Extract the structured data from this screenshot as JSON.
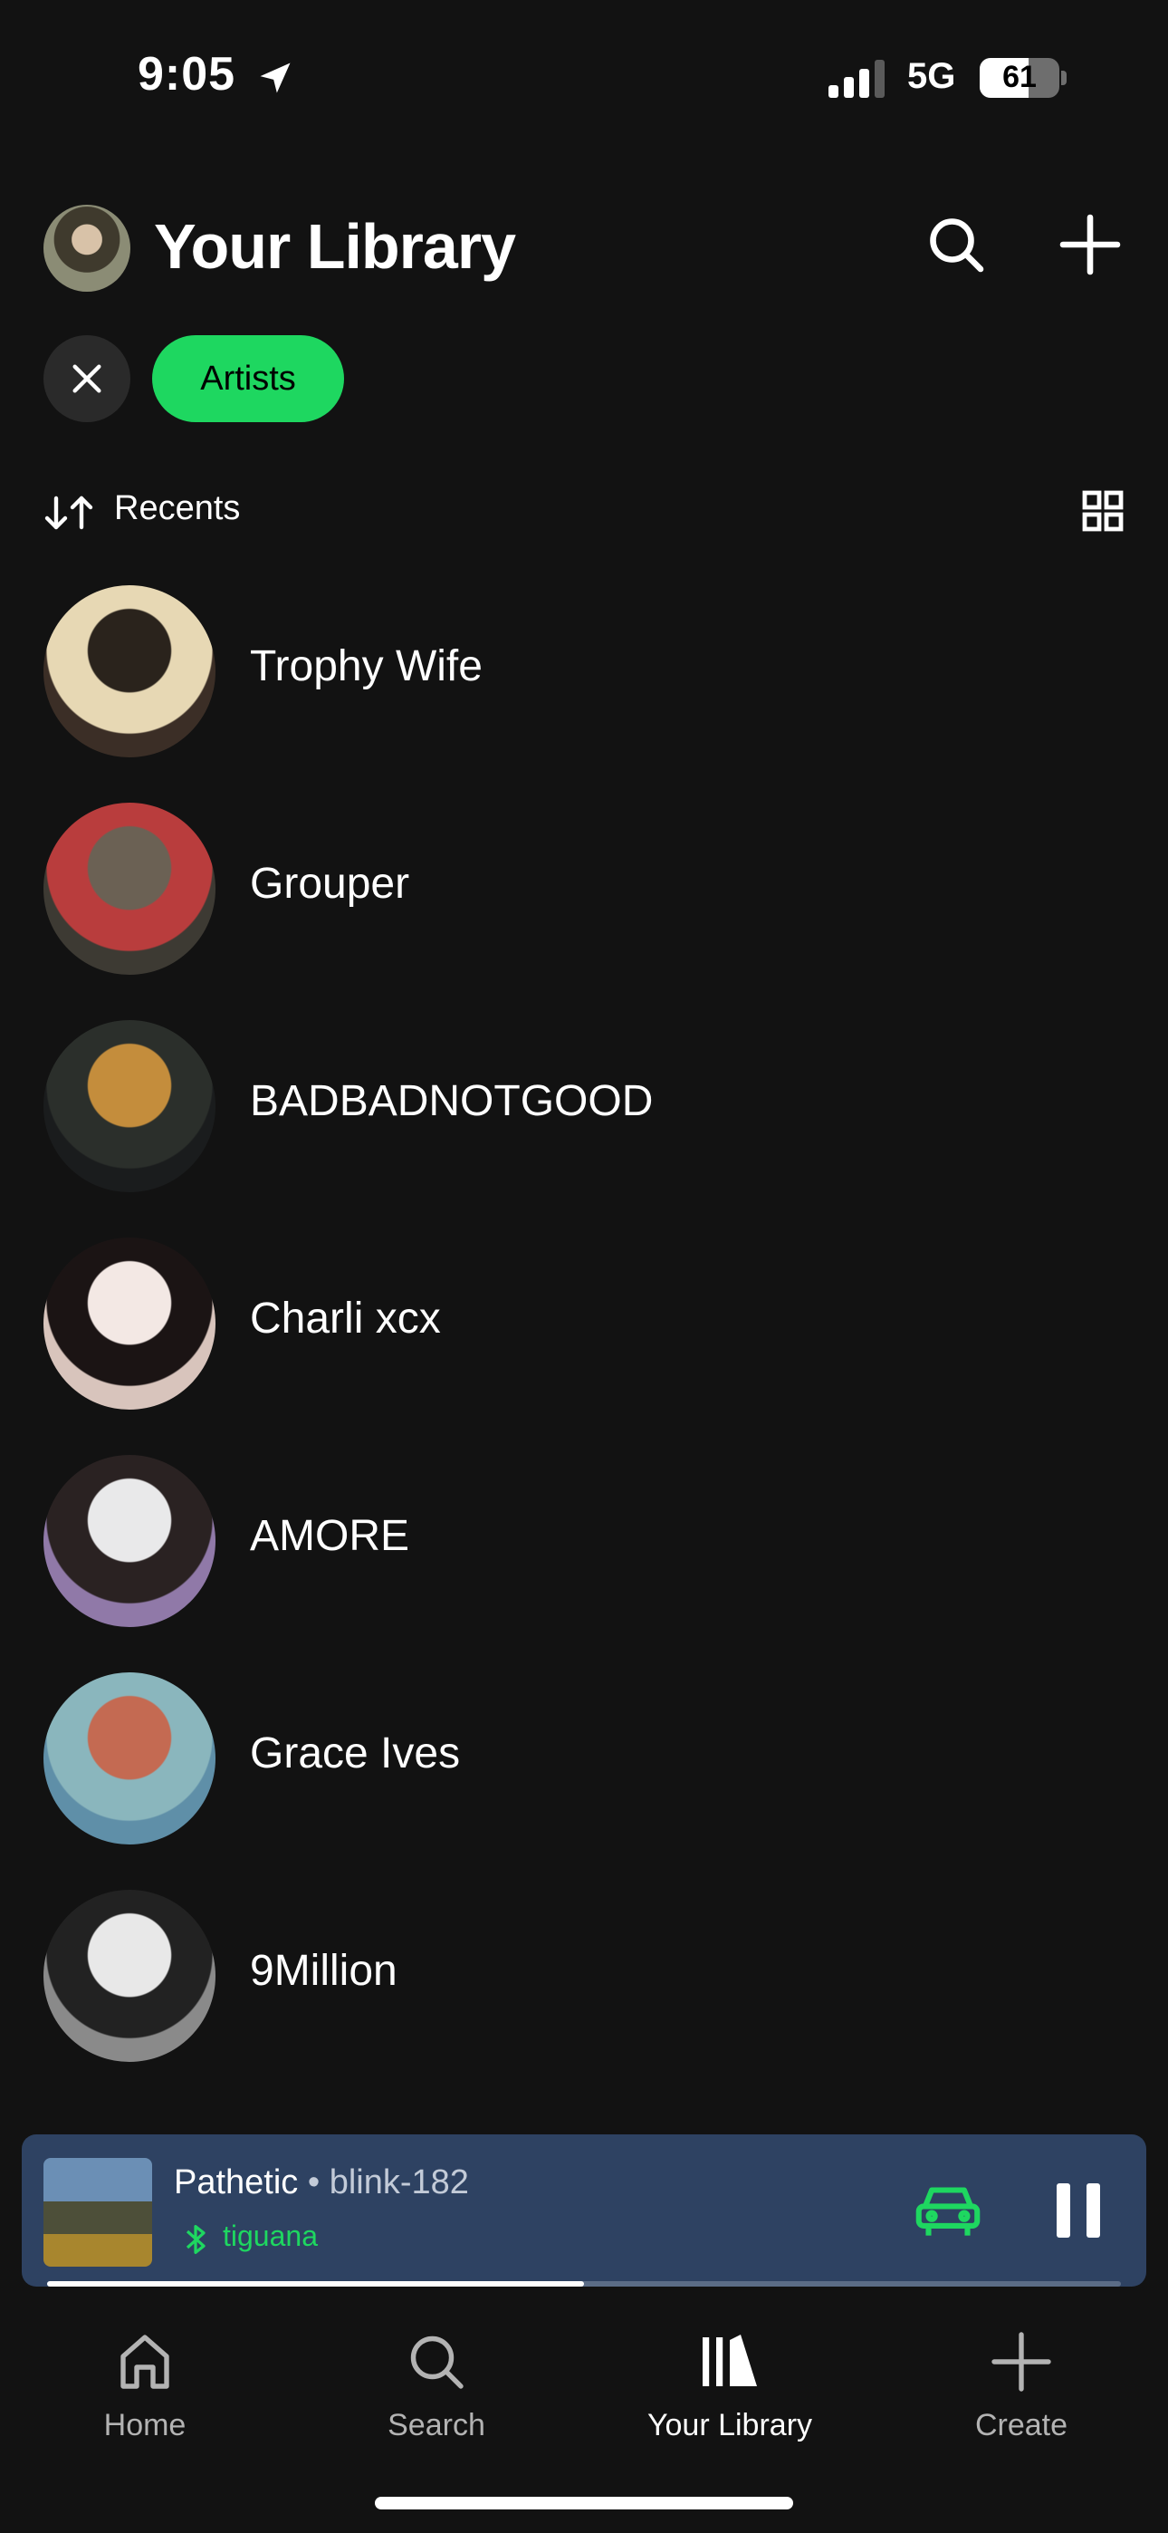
{
  "status_bar": {
    "time": "9:05",
    "network": "5G",
    "battery": "61",
    "battery_level": 0.61
  },
  "header": {
    "title": "Your Library"
  },
  "filters": {
    "active_chip": "Artists"
  },
  "sort": {
    "label": "Recents"
  },
  "artists": [
    {
      "name": "Trophy Wife",
      "colors": [
        "#2a231c",
        "#e7d8b4",
        "#3b2e26"
      ]
    },
    {
      "name": "Grouper",
      "colors": [
        "#6b6154",
        "#b93d3d",
        "#3d3a33"
      ]
    },
    {
      "name": "BADBADNOTGOOD",
      "colors": [
        "#c48d3c",
        "#2b2f2b",
        "#1a1c1d"
      ]
    },
    {
      "name": "Charli xcx",
      "colors": [
        "#f3e8e4",
        "#1b1414",
        "#d8c4bc"
      ]
    },
    {
      "name": "AMORE",
      "colors": [
        "#e9e9ea",
        "#2a2222",
        "#9079a8"
      ]
    },
    {
      "name": "Grace Ives",
      "colors": [
        "#c46a52",
        "#8ab6bd",
        "#5f8fa8"
      ]
    },
    {
      "name": "9Million",
      "colors": [
        "#e8e8e8",
        "#222222",
        "#8a8a8a"
      ]
    }
  ],
  "mini_player": {
    "song": "Pathetic",
    "separator": " • ",
    "artist": "blink-182",
    "device": "tiguana",
    "progress": 0.5,
    "accent": "#1ed760",
    "background": "#2e4262"
  },
  "tabs": [
    {
      "label": "Home",
      "icon": "home-icon",
      "active": false
    },
    {
      "label": "Search",
      "icon": "search-icon",
      "active": false
    },
    {
      "label": "Your Library",
      "icon": "library-icon",
      "active": true
    },
    {
      "label": "Create",
      "icon": "plus-icon",
      "active": false
    }
  ]
}
